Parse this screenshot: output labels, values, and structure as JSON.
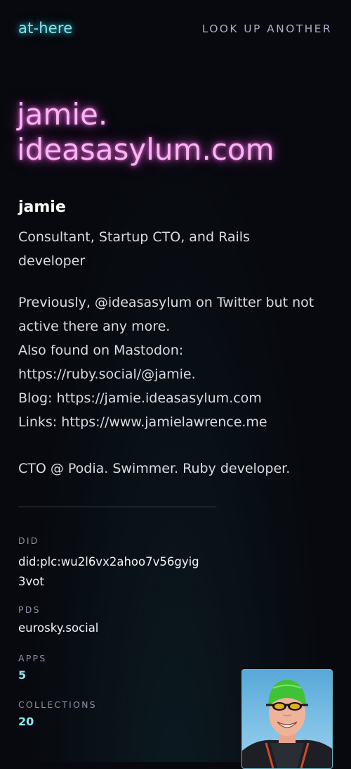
{
  "header": {
    "logo": "at-here",
    "lookup_label": "LOOK UP ANOTHER"
  },
  "profile": {
    "handle_line1": "jamie.",
    "handle_line2": "ideasasylum.com",
    "display_name": "jamie",
    "bio_paragraphs": [
      "Consultant, Startup CTO, and Rails\ndeveloper",
      "Previously, @ideasasylum on Twitter but not\nactive there any more.\nAlso found on Mastodon:\nhttps://ruby.social/@jamie.\nBlog: https://jamie.ideasasylum.com\nLinks: https://www.jamielawrence.me",
      "CTO @ Podia. Swimmer. Ruby developer."
    ]
  },
  "details": {
    "did_label": "DID",
    "did_value": "did:plc:wu2l6vx2ahoo7v56gyig\n3vot",
    "pds_label": "PDS",
    "pds_value": "eurosky.social",
    "apps_label": "APPS",
    "apps_value": "5",
    "collections_label": "COLLECTIONS",
    "collections_value": "20"
  },
  "colors": {
    "logo_glow": "#7fe6f0",
    "handle_glow": "#eb5adc",
    "accent_count": "#8fe6f2",
    "background": "#07090e"
  },
  "icons": {
    "avatar": "swimmer-avatar"
  }
}
